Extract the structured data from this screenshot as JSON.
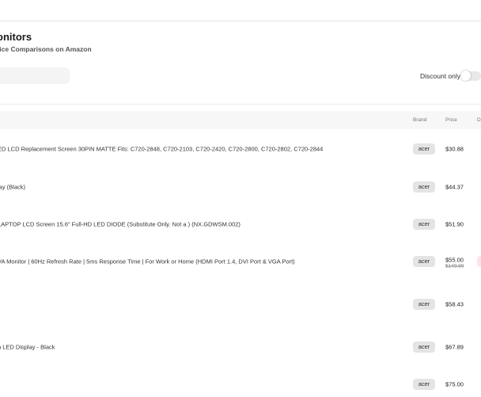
{
  "page": {
    "title": "onitors",
    "subtitle": "rice Comparisons on Amazon"
  },
  "filters": {
    "search_value": "",
    "discount_only_label": "Discount only",
    "discount_only_enabled": false
  },
  "table": {
    "columns": [
      "Brand",
      "Price",
      "D"
    ],
    "rows": [
      {
        "name": "ED LCD Replacement Screen 30PIN MATTE Fits: C720-2848, C720-2103, C720-2420, C720-2800, C720-2802, C720-2844",
        "brand": "acer",
        "price": "$30.88",
        "old_price": ""
      },
      {
        "name": "lay (Black)",
        "brand": "acer",
        "price": "$44.37",
        "old_price": ""
      },
      {
        "name": "LAPTOP LCD Screen 15.6\" Full-HD LED DIODE (Substitute Only. Not a ) (NX.GDWSM.002)",
        "brand": "acer",
        "price": "$51.90",
        "old_price": ""
      },
      {
        "name": "VA Monitor | 60Hz Refresh Rate | 5ms Response Time | For Work or Home (HDMI Port 1.4, DVI Port & VGA Port)",
        "brand": "acer",
        "price": "$55.00",
        "old_price": "$149.99"
      },
      {
        "name": "",
        "brand": "acer",
        "price": "$58.43",
        "old_price": ""
      },
      {
        "name": "n LED Display - Black",
        "brand": "acer",
        "price": "$67.89",
        "old_price": ""
      },
      {
        "name": "",
        "brand": "acer",
        "price": "$75.00",
        "old_price": ""
      }
    ]
  },
  "colors": {
    "badge_bg": "#e4e4e4",
    "discount_badge_bg": "#fce4ea",
    "header_bg": "#f7f7f7"
  }
}
